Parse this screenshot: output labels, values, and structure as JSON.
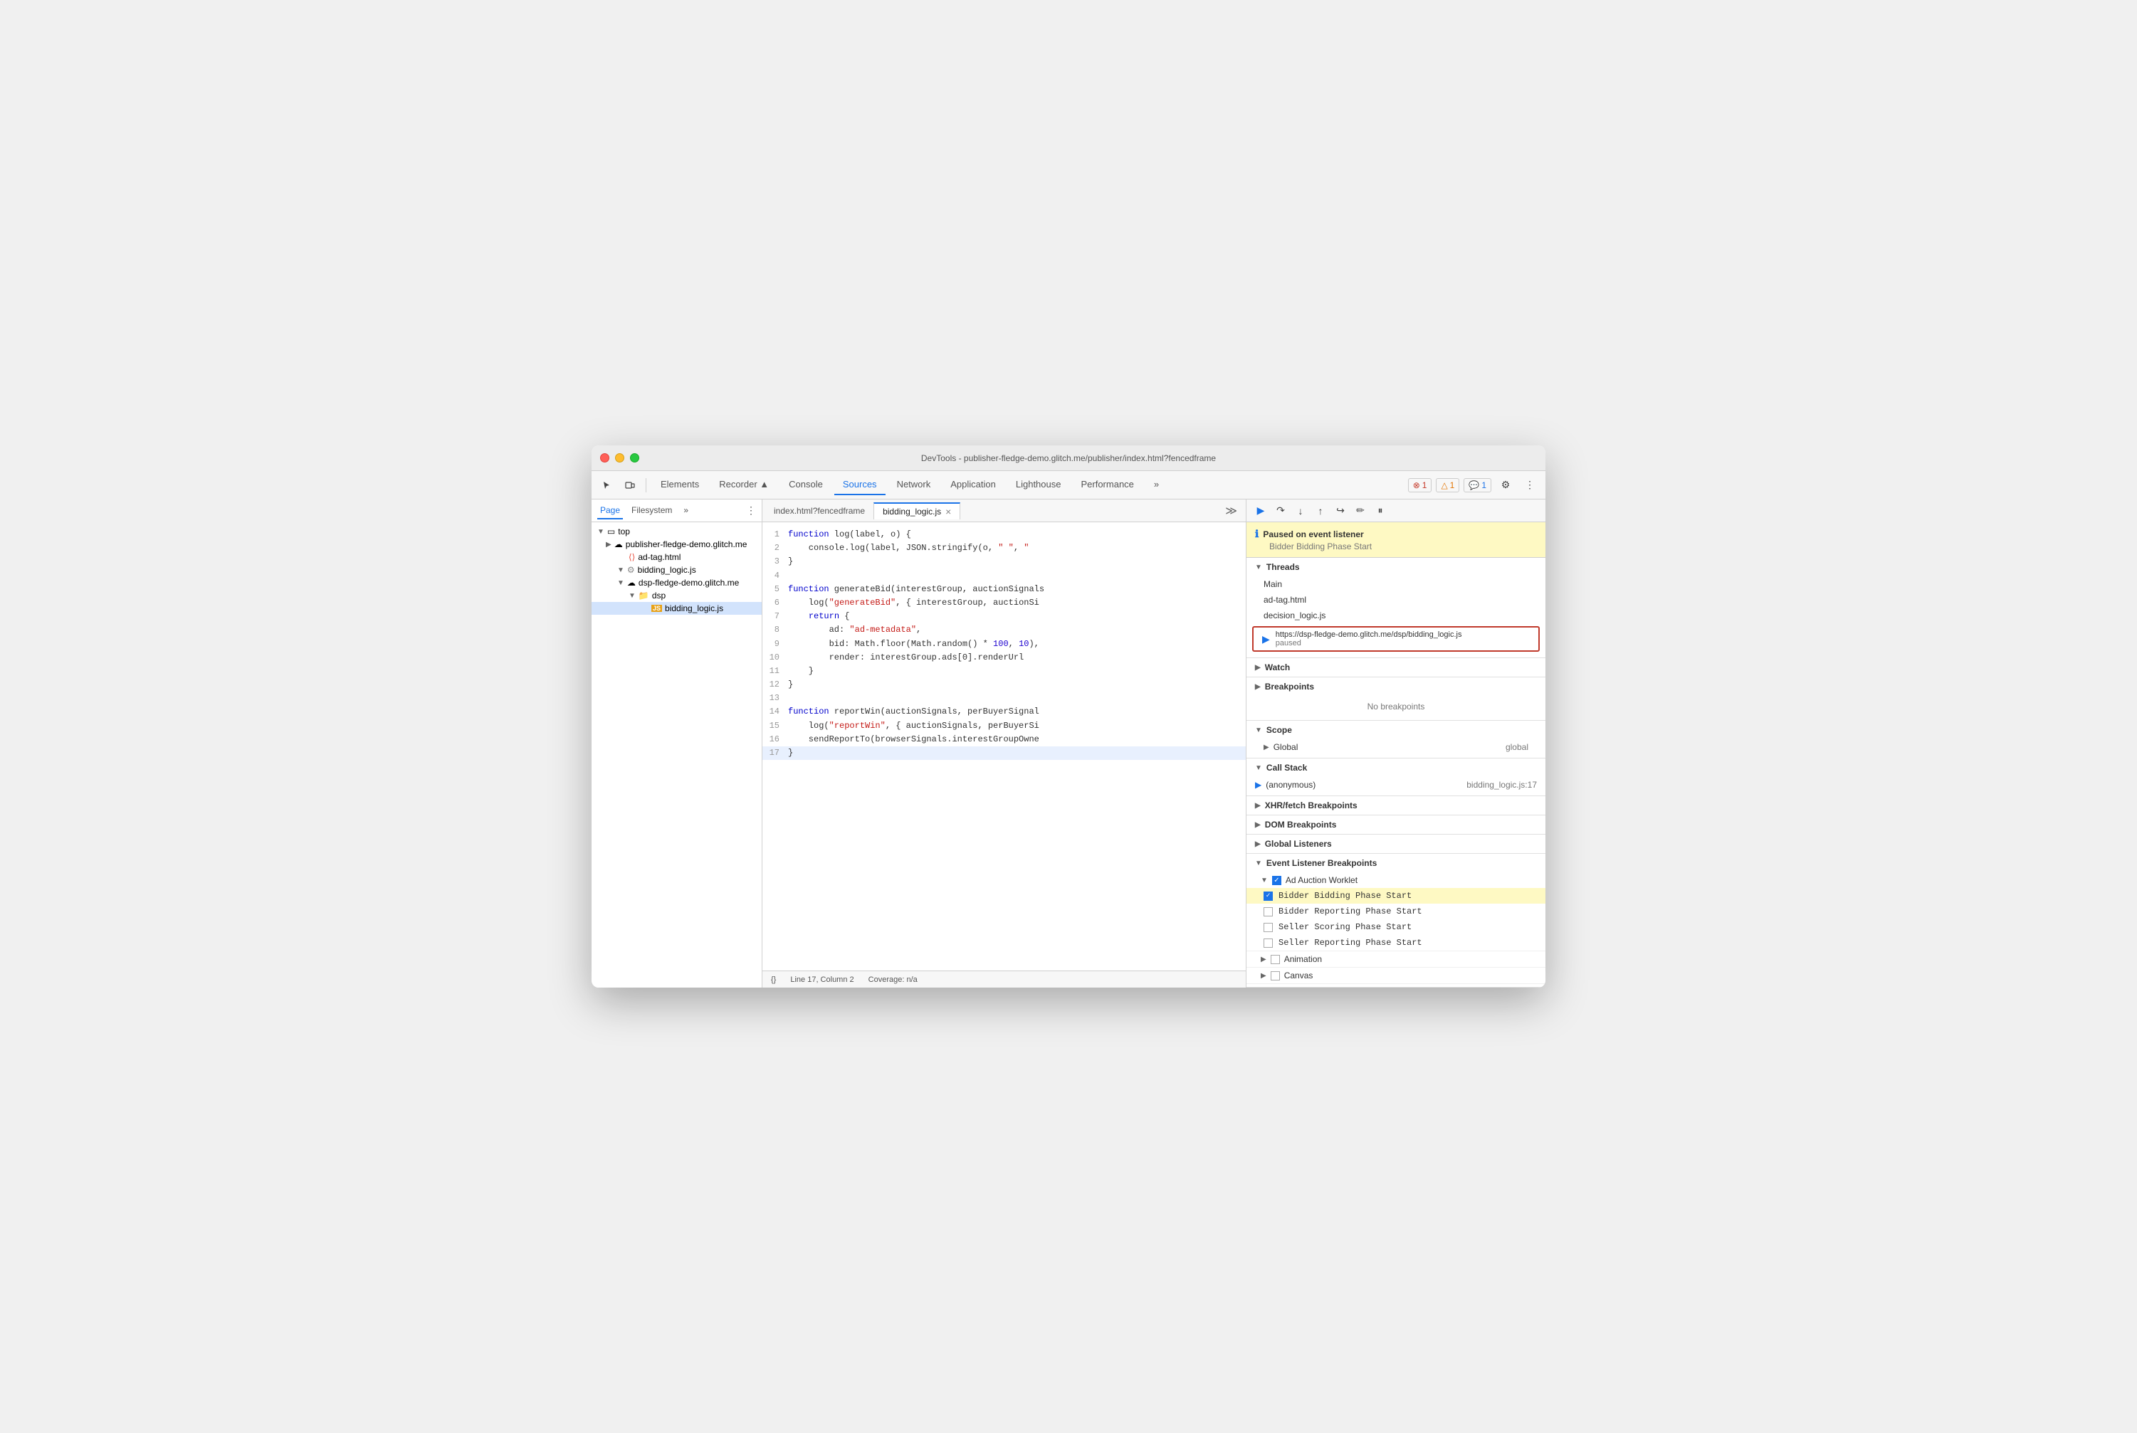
{
  "window": {
    "title": "DevTools - publisher-fledge-demo.glitch.me/publisher/index.html?fencedframe"
  },
  "toolbar": {
    "tabs": [
      "Elements",
      "Recorder ▲",
      "Console",
      "Sources",
      "Network",
      "Application",
      "Lighthouse",
      "Performance",
      "»"
    ],
    "active_tab": "Sources",
    "badges": {
      "error": "1",
      "warning": "1",
      "info": "1"
    }
  },
  "file_panel": {
    "tabs": [
      "Page",
      "Filesystem",
      "»"
    ],
    "active_tab": "Page",
    "tree": [
      {
        "label": "top",
        "level": 0,
        "type": "arrow",
        "expanded": true
      },
      {
        "label": "publisher-fledge-demo.glitch.me",
        "level": 1,
        "type": "cloud",
        "expanded": false
      },
      {
        "label": "ad-tag.html",
        "level": 2,
        "type": "html"
      },
      {
        "label": "bidding_logic.js",
        "level": 2,
        "type": "js-gear",
        "expanded": true
      },
      {
        "label": "dsp-fledge-demo.glitch.me",
        "level": 2,
        "type": "cloud",
        "expanded": true
      },
      {
        "label": "dsp",
        "level": 3,
        "type": "folder",
        "expanded": true
      },
      {
        "label": "bidding_logic.js",
        "level": 4,
        "type": "js",
        "selected": true
      }
    ]
  },
  "code_panel": {
    "tabs": [
      {
        "label": "index.html?fencedframe",
        "active": false,
        "closeable": false
      },
      {
        "label": "bidding_logic.js",
        "active": true,
        "closeable": true
      }
    ],
    "lines": [
      {
        "num": 1,
        "content": "function log(label, o) {"
      },
      {
        "num": 2,
        "content": "    console.log(label, JSON.stringify(o, \" \", \""
      },
      {
        "num": 3,
        "content": "}"
      },
      {
        "num": 4,
        "content": ""
      },
      {
        "num": 5,
        "content": "function generateBid(interestGroup, auctionSignals"
      },
      {
        "num": 6,
        "content": "    log(\"generateBid\", { interestGroup, auctionSi"
      },
      {
        "num": 7,
        "content": "    return {"
      },
      {
        "num": 8,
        "content": "        ad: \"ad-metadata\","
      },
      {
        "num": 9,
        "content": "        bid: Math.floor(Math.random() * 100, 10),"
      },
      {
        "num": 10,
        "content": "        render: interestGroup.ads[0].renderUrl"
      },
      {
        "num": 11,
        "content": "    }"
      },
      {
        "num": 12,
        "content": "}"
      },
      {
        "num": 13,
        "content": ""
      },
      {
        "num": 14,
        "content": "function reportWin(auctionSignals, perBuyerSignal"
      },
      {
        "num": 15,
        "content": "    log(\"reportWin\", { auctionSignals, perBuyerSi"
      },
      {
        "num": 16,
        "content": "    sendReportTo(browserSignals.interestGroupOwne"
      },
      {
        "num": 17,
        "content": "}",
        "highlighted": true
      }
    ],
    "status": {
      "line": "Line 17, Column 2",
      "coverage": "Coverage: n/a",
      "format": "{}"
    }
  },
  "debug_panel": {
    "toolbar_buttons": [
      "▶",
      "⟳",
      "⬇",
      "⬆",
      "⤵",
      "✏",
      "⏸"
    ],
    "paused": {
      "title": "Paused on event listener",
      "subtitle": "Bidder Bidding Phase Start"
    },
    "threads": {
      "label": "Threads",
      "items": [
        "Main",
        "ad-tag.html",
        "decision_logic.js"
      ],
      "active": {
        "url": "https://dsp-fledge-demo.glitch.me/dsp/bidding_logic.js",
        "status": "paused"
      }
    },
    "watch": {
      "label": "Watch"
    },
    "breakpoints": {
      "label": "Breakpoints",
      "empty_message": "No breakpoints"
    },
    "scope": {
      "label": "Scope",
      "items": [
        {
          "label": "Global",
          "value": "global"
        }
      ]
    },
    "call_stack": {
      "label": "Call Stack",
      "items": [
        {
          "fn": "(anonymous)",
          "loc": "bidding_logic.js:17"
        }
      ]
    },
    "xhr_breakpoints": {
      "label": "XHR/fetch Breakpoints"
    },
    "dom_breakpoints": {
      "label": "DOM Breakpoints"
    },
    "global_listeners": {
      "label": "Global Listeners"
    },
    "event_listener_breakpoints": {
      "label": "Event Listener Breakpoints",
      "sections": [
        {
          "label": "Ad Auction Worklet",
          "expanded": true,
          "items": [
            {
              "label": "Bidder Bidding Phase Start",
              "checked": true,
              "highlighted": true
            },
            {
              "label": "Bidder Reporting Phase Start",
              "checked": false
            },
            {
              "label": "Seller Scoring Phase Start",
              "checked": false
            },
            {
              "label": "Seller Reporting Phase Start",
              "checked": false
            }
          ]
        },
        {
          "label": "Animation",
          "expanded": false,
          "items": []
        },
        {
          "label": "Canvas",
          "expanded": false,
          "items": []
        }
      ]
    }
  }
}
